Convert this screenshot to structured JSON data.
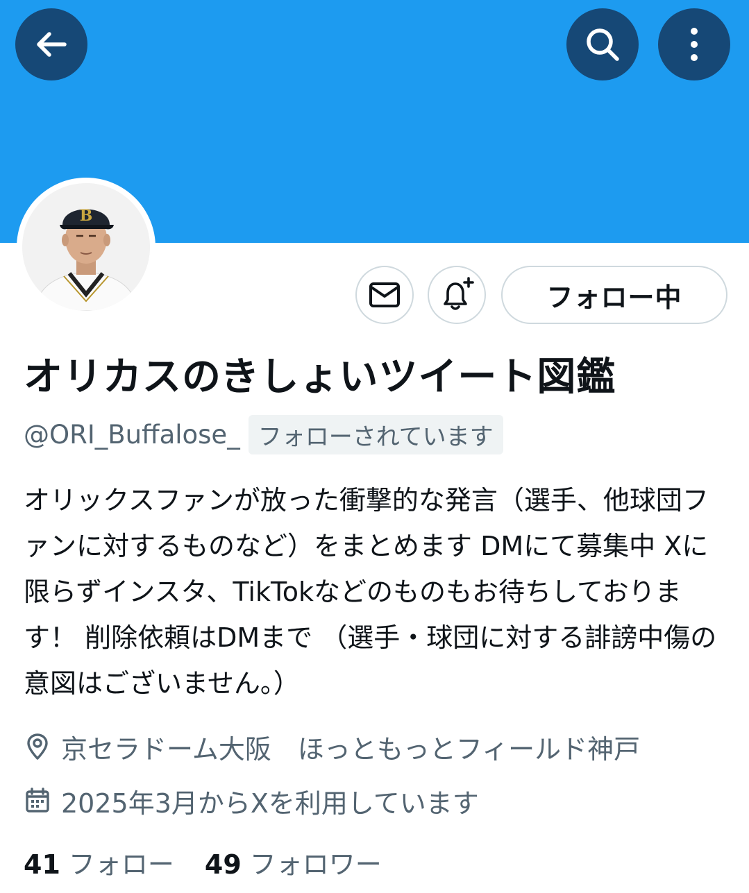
{
  "profile": {
    "display_name": "オリカスのきしょいツイート図鑑",
    "handle": "@ORI_Buffalose_",
    "follows_you_badge": "フォローされています",
    "bio": "オリックスファンが放った衝撃的な発言（選手、他球団ファンに対するものなど）をまとめます DMにて募集中 Xに限らずインスタ、TikTokなどのものもお待ちしております！ 削除依頼はDMまで （選手・球団に対する誹謗中傷の意図はございません。）",
    "location": "京セラドーム大阪　ほっともっとフィールド神戸",
    "joined": "2025年3月からXを利用しています"
  },
  "actions": {
    "following_label": "フォロー中"
  },
  "stats": {
    "following_count": "41",
    "following_label": "フォロー",
    "followers_count": "49",
    "followers_label": "フォロワー"
  },
  "icons": {
    "back": "back-arrow-icon",
    "search": "search-icon",
    "more": "more-vertical-icon",
    "message": "envelope-icon",
    "notify": "bell-plus-icon",
    "location": "location-pin-icon",
    "calendar": "calendar-icon"
  },
  "colors": {
    "banner": "#1d9bf0",
    "secondary_text": "#536471",
    "primary_text": "#0f1419",
    "border": "#cfd9de"
  }
}
